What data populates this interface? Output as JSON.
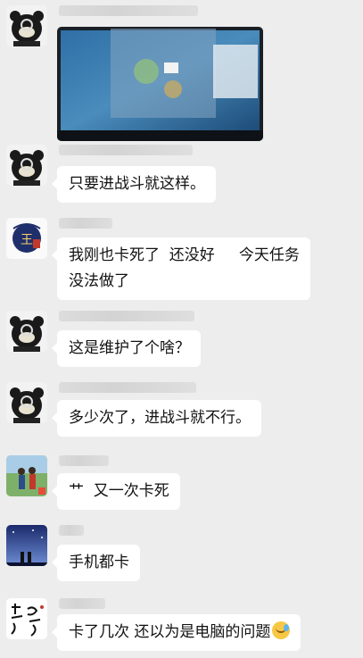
{
  "chat": {
    "messages": [
      {
        "avatar": "bear-avatar-icon",
        "type": "image"
      },
      {
        "avatar": "bear-avatar-icon",
        "type": "text",
        "text": "只要进战斗就这样。"
      },
      {
        "avatar": "wang-badge-avatar-icon",
        "type": "text",
        "text": "我刚也卡死了  还没好     今天任务\n没法做了"
      },
      {
        "avatar": "bear-avatar-icon",
        "type": "text",
        "text": "这是维护了个啥？"
      },
      {
        "avatar": "bear-avatar-icon",
        "type": "text",
        "text": "多少次了，进战斗就不行。"
      },
      {
        "avatar": "couple-photo-avatar-icon",
        "type": "text",
        "text": "艹  又一次卡死"
      },
      {
        "avatar": "night-sky-avatar-icon",
        "type": "text",
        "text": "手机都卡"
      },
      {
        "avatar": "calligraphy-avatar-icon",
        "type": "text",
        "text": "卡了几次 还以为是电脑的问题",
        "emoji": "laugh-cry-emoji-icon"
      }
    ]
  },
  "colors": {
    "background": "#ededed",
    "bubble": "#ffffff",
    "text": "#111111"
  }
}
